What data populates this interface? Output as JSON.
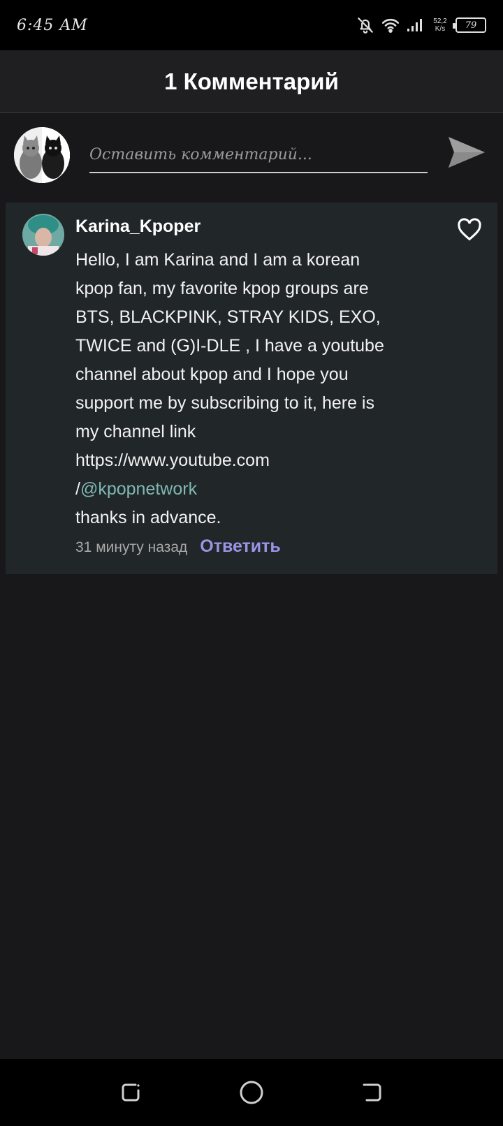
{
  "status_bar": {
    "time": "6:45 AM",
    "net_speed_value": "52,2",
    "net_speed_unit": "K/s",
    "battery": "79",
    "icons": [
      "bell-off-icon",
      "wifi-icon",
      "signal-icon",
      "battery-icon"
    ]
  },
  "header": {
    "title": "1 Комментарий"
  },
  "composer": {
    "placeholder": "Оставить комментарий..."
  },
  "comment": {
    "author": "Karina_Kpoper",
    "lines": [
      "Hello, I am Karina and I am a korean",
      "kpop fan, my favorite kpop groups are",
      "BTS, BLACKPINK, STRAY KIDS, EXO,",
      "TWICE and (G)I-DLE , I have a youtube",
      "channel about kpop and I hope you",
      "support me by subscribing to it, here is",
      "my channel link",
      "https://www.youtube.com"
    ],
    "mention_prefix": "/",
    "mention": "@kpopnetwork",
    "closing": "thanks in advance.",
    "time": "31 минуту назад",
    "reply_label": "Ответить"
  },
  "colors": {
    "background": "#18171a",
    "card": "#212628",
    "mention": "#7fb8b4",
    "reply": "#9b93e6"
  }
}
